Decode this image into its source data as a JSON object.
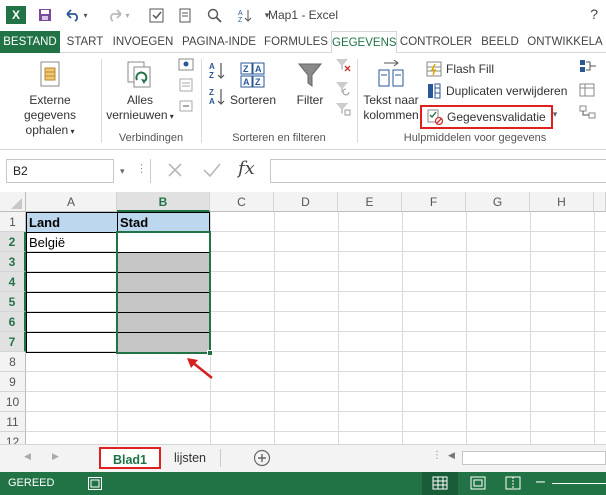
{
  "window": {
    "title": "Map1 - Excel",
    "help": "?"
  },
  "qat": {
    "app_icon": "X",
    "save_icon": "floppy-disk-icon",
    "undo_icon": "undo-icon",
    "redo_icon": "redo-icon"
  },
  "tabs": [
    {
      "label": "BESTAND"
    },
    {
      "label": "START"
    },
    {
      "label": "INVOEGEN"
    },
    {
      "label": "PAGINA-INDE"
    },
    {
      "label": "FORMULES"
    },
    {
      "label": "GEGEVENS"
    },
    {
      "label": "CONTROLER"
    },
    {
      "label": "BEELD"
    },
    {
      "label": "ONTWIKKELA"
    }
  ],
  "ribbon": {
    "external_data_line1": "Externe gegevens",
    "external_data_line2": "ophalen",
    "refresh_line1": "Alles",
    "refresh_line2": "vernieuwen",
    "group_connections": "Verbindingen",
    "sort_label": "Sorteren",
    "filter_label": "Filter",
    "group_sort_filter": "Sorteren en filteren",
    "text_to_columns_line1": "Tekst naar",
    "text_to_columns_line2": "kolommen",
    "flash_fill": "Flash Fill",
    "remove_duplicates": "Duplicaten verwijderen",
    "data_validation": "Gegevensvalidatie",
    "group_data_tools": "Hulpmiddelen voor gegevens",
    "highlight_color": "#e01f1f"
  },
  "formula_bar": {
    "name_box": "B2",
    "fx": "fx",
    "value": ""
  },
  "columns": [
    "A",
    "B",
    "C",
    "D",
    "E",
    "F",
    "G",
    "H"
  ],
  "rows": [
    "1",
    "2",
    "3",
    "4",
    "5",
    "6",
    "7",
    "8",
    "9",
    "10",
    "11",
    "12"
  ],
  "cells": {
    "A1": "Land",
    "B1": "Stad",
    "A2": "België"
  },
  "sheets": {
    "active": "Blad1",
    "other": "lijsten",
    "add_icon": "plus-circle-icon"
  },
  "status": {
    "ready": "GEREED"
  },
  "colors": {
    "excel_green": "#217346",
    "header_blue": "#bdd7ee",
    "selection_gray": "#c6c6c6",
    "annotation_red": "#e01f1f"
  }
}
